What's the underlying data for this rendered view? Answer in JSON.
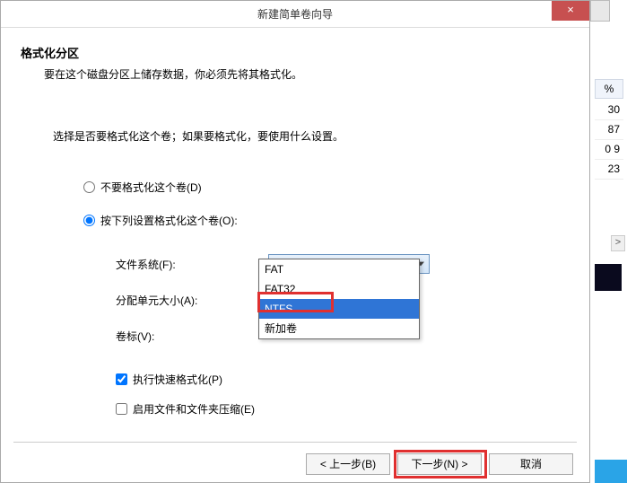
{
  "title": "新建简单卷向导",
  "close": "×",
  "header": {
    "title": "格式化分区",
    "desc": "要在这个磁盘分区上储存数据，你必须先将其格式化。"
  },
  "prompt": "选择是否要格式化这个卷；如果要格式化，要使用什么设置。",
  "radio": {
    "no_format": "不要格式化这个卷(D)",
    "do_format": "按下列设置格式化这个卷(O):"
  },
  "fields": {
    "fs_label": "文件系统(F):",
    "fs_value": "NTFS",
    "alloc_label": "分配单元大小(A):",
    "vol_label": "卷标(V):"
  },
  "dropdown": {
    "opt1": "FAT",
    "opt2": "FAT32",
    "opt3": "NTFS",
    "opt4": "新加卷"
  },
  "checks": {
    "quick": "执行快速格式化(P)",
    "compress": "启用文件和文件夹压缩(E)"
  },
  "buttons": {
    "back": "< 上一步(B)",
    "next": "下一步(N) >",
    "cancel": "取消"
  },
  "behind": {
    "hdr": "%",
    "r1": "30",
    "r2": "87",
    "r3": "0 9",
    "r4": "23",
    "scroll": ">"
  },
  "chart_data": {
    "type": "table",
    "title": "",
    "columns": [
      "%"
    ],
    "rows": [
      [
        30
      ],
      [
        87
      ],
      [
        9
      ],
      [
        23
      ]
    ]
  }
}
